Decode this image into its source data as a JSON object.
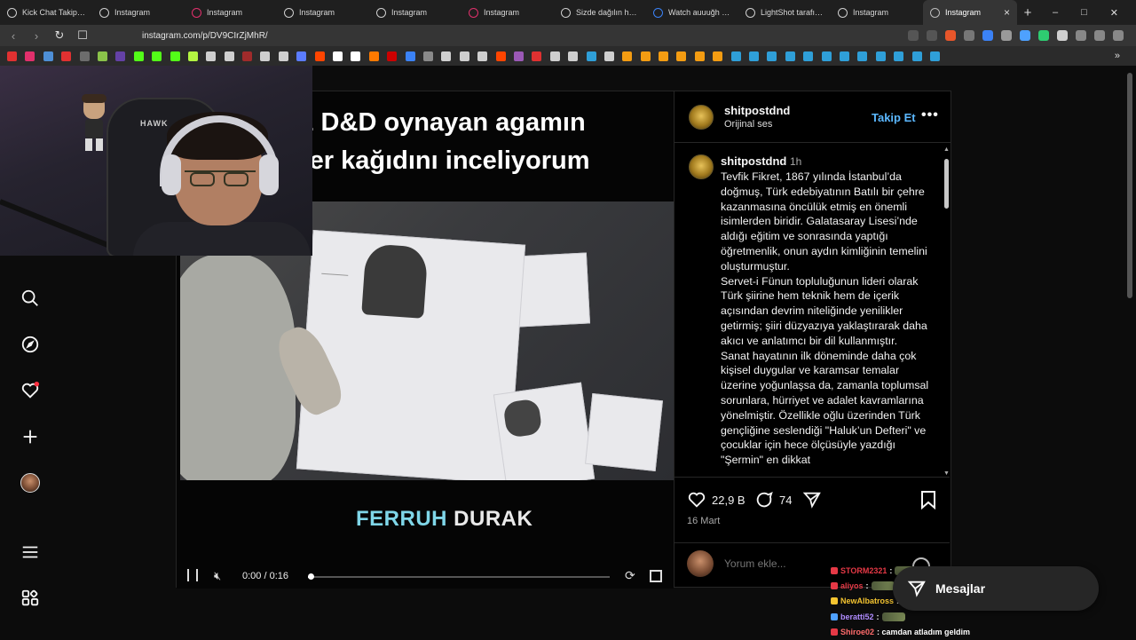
{
  "browser": {
    "tabs": [
      {
        "label": "Kick Chat Takip | W",
        "favicon": "#cfcfcf"
      },
      {
        "label": "Instagram",
        "favicon": "#cfcfcf"
      },
      {
        "label": "Instagram",
        "favicon": "#e1306c"
      },
      {
        "label": "Instagram",
        "favicon": "#cfcfcf"
      },
      {
        "label": "Instagram",
        "favicon": "#cfcfcf"
      },
      {
        "label": "Instagram",
        "favicon": "#e1306c"
      },
      {
        "label": "Sizde dağılın hemşe",
        "favicon": "#cfcfcf"
      },
      {
        "label": "Watch auuuğh | Str",
        "favicon": "#3b82f6"
      },
      {
        "label": "LightShot tarafından",
        "favicon": "#cfcfcf"
      },
      {
        "label": "Instagram",
        "favicon": "#cfcfcf"
      }
    ],
    "active_tab": {
      "label": "Instagram",
      "close": "×"
    },
    "new_tab": "+",
    "window_controls": {
      "minimize": "–",
      "maximize": "□",
      "close": "✕"
    },
    "url": "instagram.com/p/DV9CIrZjMhR/",
    "nav": {
      "back": "‹",
      "forward": "›",
      "reload": "↻",
      "bookmark": "☐"
    },
    "bookmark_colors": [
      "#e03131",
      "#e1306c",
      "#4e8fd6",
      "#e03131",
      "#6c6c6c",
      "#8bc34a",
      "#6441a5",
      "#53fc18",
      "#53fc18",
      "#53fc18",
      "#b3f542",
      "#cfcfcf",
      "#cfcfcf",
      "#a02b2b",
      "#cfcfcf",
      "#cfcfcf",
      "#5b7cff",
      "#ff4500",
      "#ffffff",
      "#ffffff",
      "#ff7a00",
      "#cc0000",
      "#3b82f6",
      "#8a8a8a",
      "#d0d0d0",
      "#cfcfcf",
      "#cfcfcf",
      "#ff4500",
      "#9b59b6",
      "#e03131",
      "#cfcfcf",
      "#cfcfcf",
      "#2f9fd8",
      "#cfcfcf",
      "#f39c12",
      "#f39c12",
      "#f39c12",
      "#f39c12",
      "#f39c12",
      "#f39c12",
      "#2f9fd8",
      "#2f9fd8",
      "#2f9fd8",
      "#2f9fd8",
      "#2f9fd8",
      "#2f9fd8",
      "#2f9fd8",
      "#2f9fd8",
      "#2f9fd8",
      "#2f9fd8",
      "#2f9fd8",
      "#2f9fd8"
    ],
    "bookmarks_overflow": "»"
  },
  "post": {
    "video": {
      "title_text": "z D&D oynayan agamın\nter kağıdını inceliyorum",
      "caption_first": "FERRUH",
      "caption_last": "DURAK",
      "time": "0:00 / 0:16",
      "progress": 0.01
    },
    "header": {
      "username": "shitpostdnd",
      "audio": "Orijinal ses",
      "follow": "Takip Et",
      "more": "•••"
    },
    "caption": {
      "username": "shitpostdnd",
      "time": "1h",
      "text": "Tevfik Fikret, 1867 yılında İstanbul’da doğmuş, Türk edebiyatının Batılı bir çehre kazanmasına öncülük etmiş en önemli isimlerden biridir. Galatasaray Lisesi’nde aldığı eğitim ve sonrasında yaptığı öğretmenlik, onun aydın kimliğinin temelini oluşturmuştur.\nServet-i Fünun topluluğunun lideri olarak Türk şiirine hem teknik hem de içerik açısından devrim niteliğinde yenilikler getirmiş; şiiri düzyazıya yaklaştırarak daha akıcı ve anlatımcı bir dil kullanmıştır.\nSanat hayatının ilk döneminde daha çok kişisel duygular ve karamsar temalar üzerine yoğunlaşsa da, zamanla toplumsal sorunlara, hürriyet ve adalet kavramlarına yönelmiştir. Özellikle oğlu üzerinden Türk gençliğine seslendiği \"Haluk’un Defteri\" ve çocuklar için hece ölçüsüyle yazdığı \"Şermin\" en dikkat"
    },
    "actions": {
      "likes": "22,9 B",
      "comments": "74",
      "date": "16 Mart"
    },
    "add_comment_placeholder": "Yorum ekle..."
  },
  "cam": {
    "chair_brand": "HAWK"
  },
  "chat": [
    {
      "user": "STORM2321",
      "color": "#e63946",
      "badge": "#e63946",
      "msg": " : ",
      "emote": true
    },
    {
      "user": "aliyos",
      "color": "#e63946",
      "badge": "#e63946",
      "msg": " : ",
      "emote": true
    },
    {
      "user": "NewAlbatross",
      "color": "#f4c430",
      "badge": "#f4c430",
      "msg": " : el prezo",
      "emote": false
    },
    {
      "user": "beratti52",
      "color": "#b08cff",
      "badge": "#4ea1ff",
      "msg": " : ",
      "emote": true
    },
    {
      "user": "Shiroe02",
      "color": "#ff6b6b",
      "badge": "#e63946",
      "msg": " : camdan atladım geldim",
      "emote": false
    }
  ],
  "messages_button": {
    "label": "Mesajlar"
  }
}
